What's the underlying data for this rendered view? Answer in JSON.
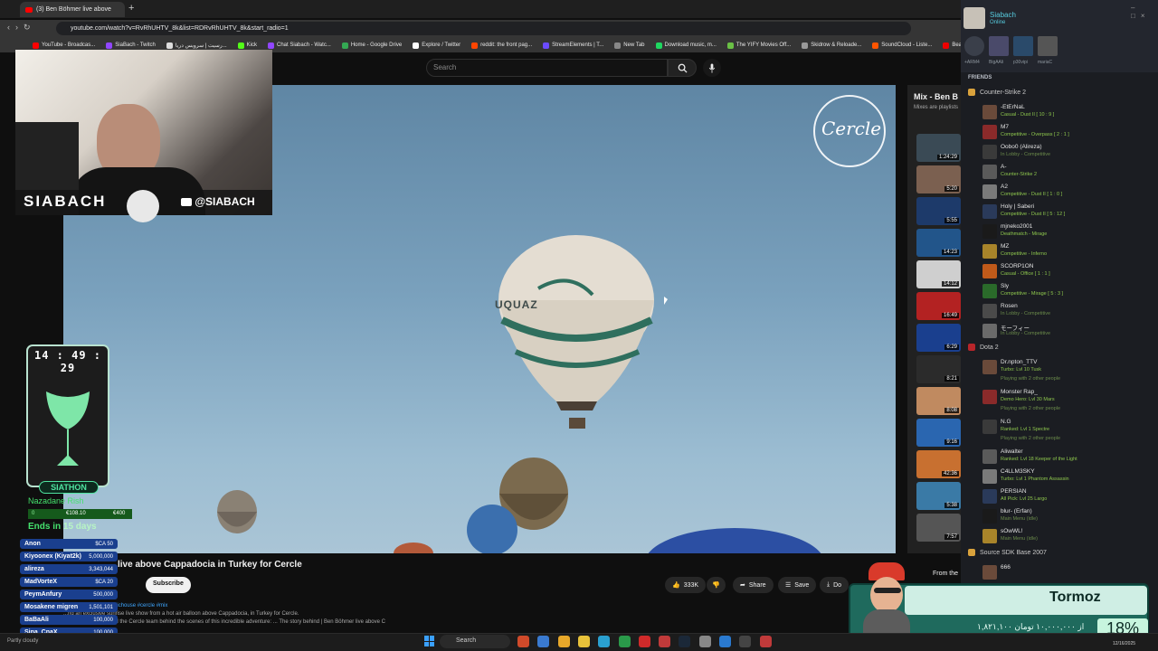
{
  "browser": {
    "tab_title": "(3) Ben Böhmer live above",
    "url": "youtube.com/watch?v=RvRhUHTV_8k&list=RDRvRhUHTV_8k&start_radio=1",
    "bookmarks": [
      "YouTube - Broadcas...",
      "SiaBach - Twitch",
      "رسیت | سرویس دریا...",
      "Kick",
      "Chat Siabach - Watc...",
      "Home - Google Drive",
      "Explore / Twitter",
      "reddit: the front pag...",
      "StreamElements | T...",
      "New Tab",
      "Download music, m...",
      "The YIFY Movies Off...",
      "Skidrow & Reloade...",
      "SoundCloud - Liste...",
      "BeatStars | World's..."
    ]
  },
  "youtube": {
    "search_placeholder": "Search",
    "video_title": "live above Cappadocia in Turkey for Cercle",
    "channel_watermark": "Cercle",
    "balloon_text": "UQUAZ",
    "subscribe_label": "Subscribe",
    "likes": "333K",
    "share_label": "Share",
    "save_label": "Save",
    "download_label": "Do",
    "views_line": "... 5 years ago  #melodichouse #cercle #mix",
    "desc_line1": "...ng an exclusive sunrise live show from a hot air balloon above Cappadocia, in Turkey for Cercle.",
    "desc_line2": "...ixle Ben Böhmer and the Cercle team behind the scenes of this incredible adventure: ... The story behind | Ben Böhmer live above C",
    "playlist_title": "Mix - Ben B",
    "playlist_sub": "Mixes are playlists",
    "from_the": "From the",
    "durations": [
      "1:24:29",
      "5:20",
      "5:55",
      "14:23",
      "14:12",
      "16:49",
      "6:29",
      "8:21",
      "8:08",
      "9:16",
      "42:36",
      "5:38",
      "7:57"
    ],
    "partly_cloudy": "Partly cloudy"
  },
  "overlay": {
    "streamer_name": "SIABACH",
    "handle": "@SIABACH",
    "clock": "14 : 49 : 29",
    "siathon": "SIATHON",
    "goal_title": "Nazadane Rish",
    "goal_start": "0",
    "goal_current": "€108.10",
    "goal_target": "€400",
    "ends_prefix": "Ends in",
    "ends_value": "15 days",
    "donations": [
      {
        "name": "Anon",
        "amount": "$CA 50"
      },
      {
        "name": "Kiyoonex (Kiyat2k)",
        "amount": "5,000,000"
      },
      {
        "name": "alireza",
        "amount": "3,343,044"
      },
      {
        "name": "MadVorteX",
        "amount": "$CA 20"
      },
      {
        "name": "PeymAnfury",
        "amount": "500,000"
      },
      {
        "name": "Mosakene migren",
        "amount": "1,501,101"
      },
      {
        "name": "BaBaAli",
        "amount": "100,000"
      },
      {
        "name": "Sina_CnaX",
        "amount": "100,000"
      }
    ]
  },
  "steam": {
    "user": "Siabach",
    "status": "Online",
    "recent": [
      "+ARM4",
      "BigAAli",
      "p30vipi",
      "mariaC"
    ],
    "friends_label": "FRIENDS",
    "groups": [
      {
        "game": "Counter-Strike 2",
        "friends": [
          {
            "name": "-EtErNaL",
            "status": "Casual - Dust II [ 10 : 9 ]"
          },
          {
            "name": "M7",
            "status": "Competitive - Overpass [ 2 : 1 ]"
          },
          {
            "name": "Oobo0  (Alireza)",
            "status": "In Lobby - Competitive"
          },
          {
            "name": "A-",
            "status": "Counter-Strike 2"
          },
          {
            "name": "A2",
            "status": "Competitive - Dust II [ 1 : 0 ]"
          },
          {
            "name": "Holy | Saberi",
            "status": "Competitive - Dust II [ 5 : 12 ]"
          },
          {
            "name": "mjneko2001",
            "status": "Deathmatch - Mirage"
          },
          {
            "name": "MZ",
            "status": "Competitive - Inferno"
          },
          {
            "name": "SCORP1ON",
            "status": "Casual - Office [ 1 : 1 ]"
          },
          {
            "name": "Sly",
            "status": "Competitive - Mirage [ 5 : 3 ]"
          },
          {
            "name": "Rosen",
            "status": "In Lobby - Competitive"
          },
          {
            "name": "モーフィー",
            "status": "In Lobby - Competitive"
          }
        ]
      },
      {
        "game": "Dota 2",
        "friends": [
          {
            "name": "Dr.npton_TTV",
            "status": "Turbo: Lvl 10 Tusk",
            "extra": "Playing with 2 other people"
          },
          {
            "name": "Monster Rap_",
            "status": "Demo Hero: Lvl 30 Mars",
            "extra": "Playing with 2 other people"
          },
          {
            "name": "N.G",
            "status": "Ranked: Lvl 1 Spectre",
            "extra": "Playing with 2 other people"
          },
          {
            "name": "Aliwalter",
            "status": "Ranked: Lvl 18 Keeper of the Light"
          },
          {
            "name": "C4LLM3SKY",
            "status": "Turbo: Lvl 1 Phantom Assassin"
          },
          {
            "name": "PERSIAN",
            "status": "All Pick: Lvl 25 Largo"
          },
          {
            "name": "blur-  (Erfan)",
            "status": "Main Menu (idle)"
          },
          {
            "name": "sOwWL!",
            "status": "Main Menu (idle)"
          }
        ]
      },
      {
        "game": "Source SDK Base 2007",
        "friends": [
          {
            "name": "666",
            "status": ""
          }
        ]
      }
    ]
  },
  "tormoz": {
    "name": "Tormoz",
    "amount": "۱,۸۲۱,۱۰۰ از ۱۰,۰۰۰,۰۰۰ تومان",
    "percent": "18%"
  },
  "taskbar": {
    "search_label": "Search",
    "date": "12/16/2025"
  }
}
